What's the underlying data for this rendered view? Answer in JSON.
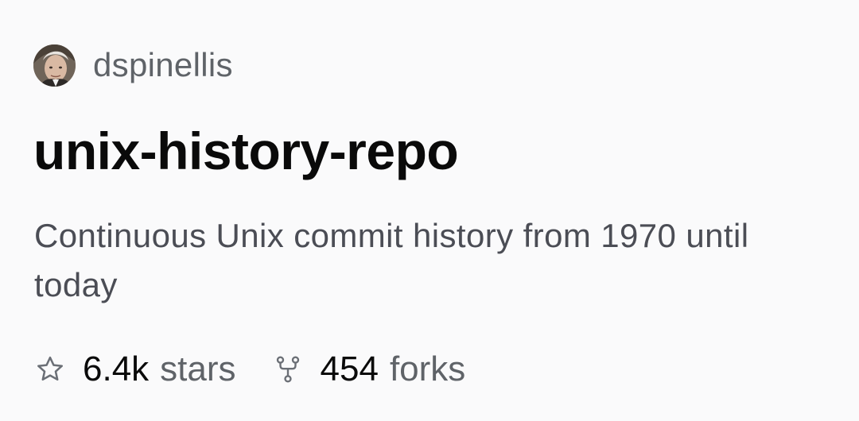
{
  "owner": {
    "username": "dspinellis"
  },
  "repo": {
    "name": "unix-history-repo",
    "description": "Continuous Unix commit history from 1970 until today"
  },
  "stats": {
    "stars": {
      "count": "6.4k",
      "label": "stars",
      "icon": "star-icon"
    },
    "forks": {
      "count": "454",
      "label": "forks",
      "icon": "fork-icon"
    }
  },
  "colors": {
    "background": "#fafafb",
    "title": "#0a0a0a",
    "muted": "#5f6368",
    "description": "#4b4d55"
  }
}
